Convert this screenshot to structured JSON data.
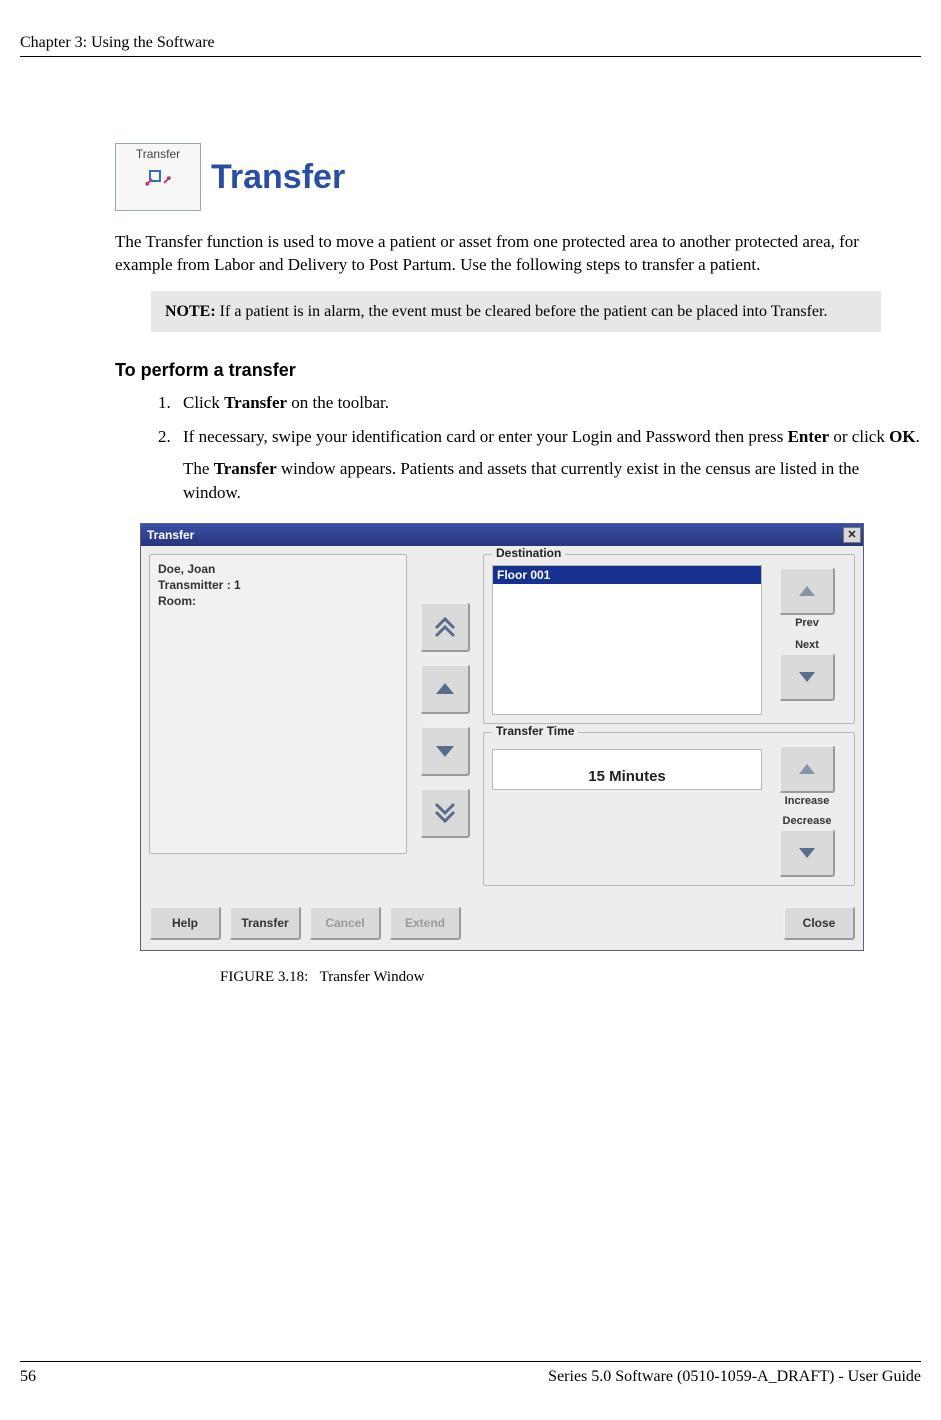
{
  "header": {
    "running": "Chapter 3: Using the Software"
  },
  "section": {
    "icon_label": "Transfer",
    "title": "Transfer",
    "intro": "The Transfer function is used to move a patient or asset from one protected area to another protected area, for example from Labor and Delivery to Post Partum. Use the following steps to transfer a patient.",
    "note_label": "NOTE:",
    "note_text": " If a patient is in alarm, the event must be cleared before the patient can be placed into Transfer.",
    "subhead": "To perform a transfer",
    "steps": {
      "s1_a": "Click ",
      "s1_b": "Transfer",
      "s1_c": " on the toolbar.",
      "s2_a": "If necessary, swipe your identification card or enter your Login and Password then press ",
      "s2_b": "Enter",
      "s2_c": " or click ",
      "s2_d": "OK",
      "s2_e": ".",
      "s2_follow_a": "The ",
      "s2_follow_b": "Transfer",
      "s2_follow_c": " window appears. Patients and assets that currently exist in the census are listed in the window."
    }
  },
  "window": {
    "title": "Transfer",
    "close_glyph": "✕",
    "patient": {
      "name_line": "Doe, Joan",
      "tx_line": "Transmitter : 1",
      "room_line": "Room:"
    },
    "destination": {
      "legend": "Destination",
      "items": [
        "Floor 001"
      ],
      "prev": "Prev",
      "next": "Next"
    },
    "transfer_time": {
      "legend": "Transfer Time",
      "value": "15 Minutes",
      "increase": "Increase",
      "decrease": "Decrease"
    },
    "footer": {
      "help": "Help",
      "transfer": "Transfer",
      "cancel": "Cancel",
      "extend": "Extend",
      "close": "Close"
    }
  },
  "figure": {
    "label": "FIGURE 3.18:",
    "caption": "Transfer Window"
  },
  "footer": {
    "page": "56",
    "right": "Series 5.0 Software (0510-1059-A_DRAFT) - User Guide"
  }
}
